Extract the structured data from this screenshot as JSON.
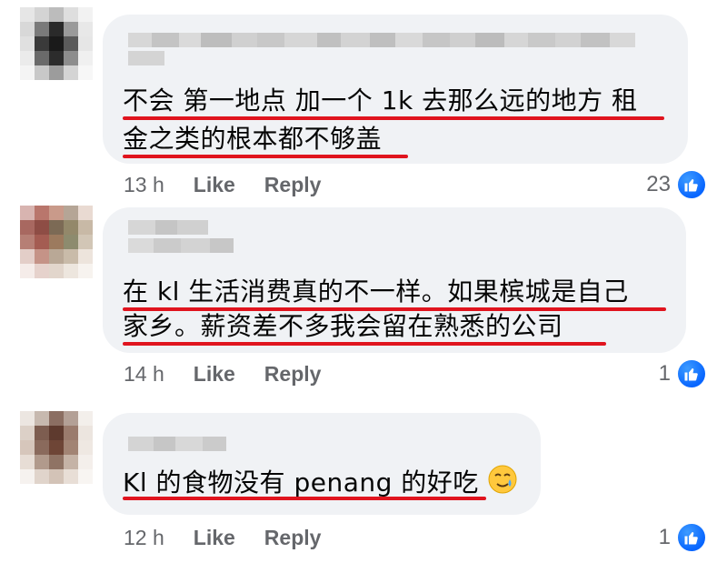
{
  "comments": [
    {
      "lines": [
        "不会 第一地点 加一个 1k 去那么远的地方 租",
        "金之类的根本都不够盖"
      ],
      "time": "13 h",
      "like_label": "Like",
      "reply_label": "Reply",
      "reactions": "23",
      "reaction_icon": "thumbs-up-icon"
    },
    {
      "lines": [
        "在 kl 生活消费真的不一样。如果槟城是自己",
        "家乡。薪资差不多我会留在熟悉的公司"
      ],
      "time": "14 h",
      "like_label": "Like",
      "reply_label": "Reply",
      "reactions": "1",
      "reaction_icon": "thumbs-up-icon"
    },
    {
      "lines": [
        "Kl 的食物没有 penang 的好吃"
      ],
      "emoji": "tearful-smile-emoji",
      "time": "12 h",
      "like_label": "Like",
      "reply_label": "Reply",
      "reactions": "1",
      "reaction_icon": "thumbs-up-icon"
    }
  ],
  "colors": {
    "bubble": "#f0f2f5",
    "underline": "#e0141e",
    "meta_text": "#65676b",
    "like_blue": "#0866ff"
  }
}
